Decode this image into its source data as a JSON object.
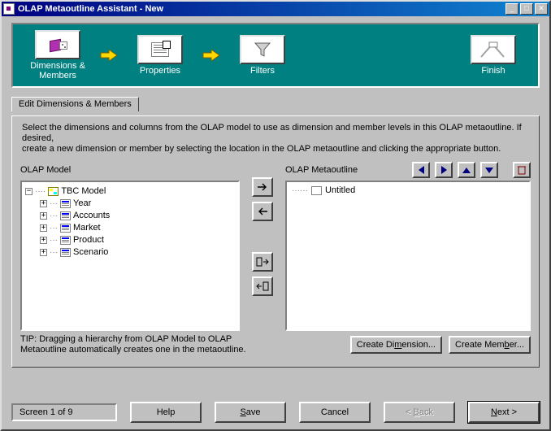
{
  "window": {
    "title": "OLAP Metaoutline Assistant - New"
  },
  "steps": {
    "s1": "Dimensions & Members",
    "s2": "Properties",
    "s3": "Filters",
    "s4": "Finish"
  },
  "tab": {
    "label": "Edit Dimensions & Members"
  },
  "instructions": {
    "line1": "Select the dimensions and columns from the OLAP model to use as dimension and member levels in this OLAP metaoutline. If desired,",
    "line2": "create a new dimension or member by selecting the location in the OLAP metaoutline and clicking the appropriate button."
  },
  "labels": {
    "olap_model": "OLAP Model",
    "olap_metaoutline": "OLAP Metaoutline"
  },
  "model": {
    "root": "TBC Model",
    "items": [
      "Year",
      "Accounts",
      "Market",
      "Product",
      "Scenario"
    ]
  },
  "metaoutline": {
    "root": "Untitled"
  },
  "tip": "TIP: Dragging a hierarchy from OLAP Model to OLAP Metaoutline automatically creates one in the metaoutline.",
  "buttons": {
    "create_dimension": "Create Dimension...",
    "create_member": "Create Member...",
    "help": "Help",
    "save": "Save",
    "cancel": "Cancel",
    "back": "< Back",
    "next": "Next >"
  },
  "footer": {
    "screen": "Screen 1 of 9"
  }
}
